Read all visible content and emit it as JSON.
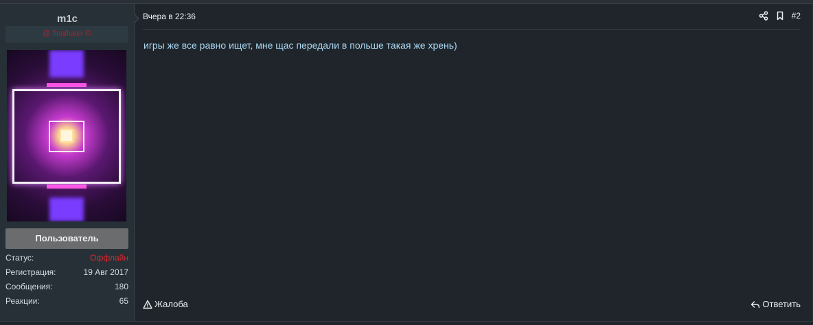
{
  "user": {
    "name": "m1c",
    "title": "@ finalhaler ©",
    "role_button": "Пользователь",
    "stats": [
      {
        "label": "Статус:",
        "value": "Оффлайн"
      },
      {
        "label": "Регистрация:",
        "value": "19 Авг 2017"
      },
      {
        "label": "Сообщения:",
        "value": "180"
      },
      {
        "label": "Реакции:",
        "value": "65"
      }
    ]
  },
  "post": {
    "date": "Вчера в 22:36",
    "number": "#2",
    "message": "игры же все равно ищет, мне щас передали в польше такая же хрень)",
    "report_label": "Жалоба",
    "reply_label": "Ответить"
  },
  "icons": {
    "share": "share-icon",
    "bookmark": "bookmark-icon",
    "report": "warning-icon",
    "reply": "reply-icon"
  },
  "colors": {
    "background": "#1f252a",
    "user_panel": "#263036",
    "message_text": "#a9d6f2",
    "offline_status": "#e0262f",
    "user_title": "#b21f2a"
  }
}
